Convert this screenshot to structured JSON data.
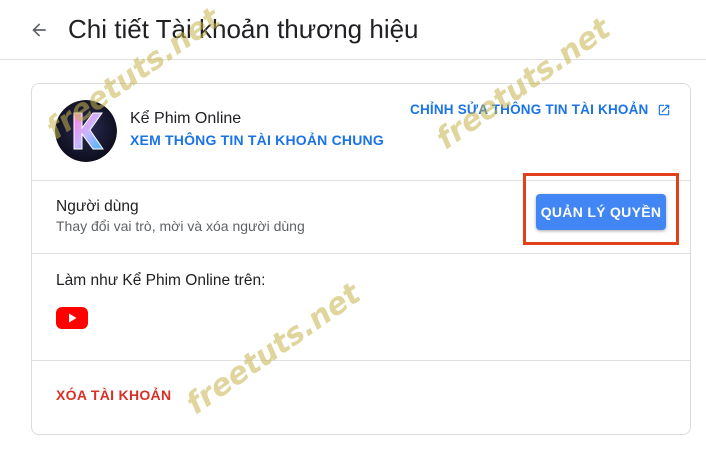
{
  "header": {
    "title": "Chi tiết Tài khoản thương hiệu"
  },
  "account": {
    "name": "Kể Phim Online",
    "view_general_link": "XEM THÔNG TIN TÀI KHOẢN CHUNG",
    "edit_link": "CHỈNH SỬA THÔNG TIN TÀI KHOẢN"
  },
  "users": {
    "title": "Người dùng",
    "subtitle": "Thay đổi vai trò, mời và xóa người dùng",
    "manage_button": "QUẢN LÝ QUYỀN"
  },
  "act_as": {
    "label": "Làm như Kể Phim Online trên:"
  },
  "danger": {
    "delete_link": "XÓA TÀI KHOẢN"
  },
  "watermark": "freetuts.net",
  "colors": {
    "link": "#1a73e8",
    "button": "#4285f4",
    "danger": "#d93025",
    "highlight_border": "#e0401a",
    "youtube": "#ff0000"
  },
  "icons": {
    "back": "arrow-left-icon",
    "edit": "open-in-new-icon",
    "youtube": "youtube-icon"
  }
}
